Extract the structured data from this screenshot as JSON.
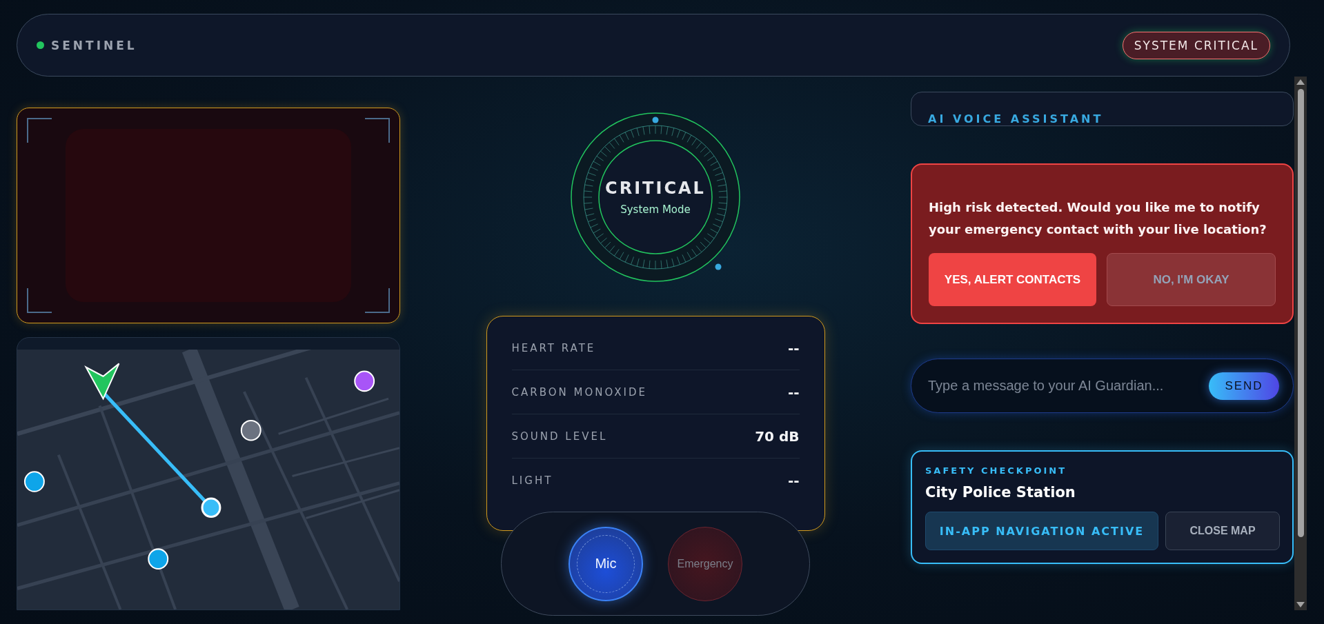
{
  "header": {
    "brand": "SENTINEL",
    "online": true,
    "badge": "SYSTEM CRITICAL"
  },
  "mode": {
    "title": "CRITICAL",
    "subtitle": "System Mode"
  },
  "sensors": [
    {
      "label": "HEART RATE",
      "value": "--"
    },
    {
      "label": "CARBON MONOXIDE",
      "value": "--"
    },
    {
      "label": "SOUND LEVEL",
      "value": "70 dB"
    },
    {
      "label": "LIGHT",
      "value": "--"
    }
  ],
  "controls": [
    {
      "label": "Mic",
      "kind": "mic",
      "active": true
    },
    {
      "label": "Emergency",
      "kind": "emergency",
      "active": false
    }
  ],
  "assistant": {
    "title": "AI VOICE ASSISTANT"
  },
  "alert": {
    "message": "High risk detected. Would you like me to notify your emergency contact with your live location?",
    "buttons": [
      {
        "label": "YES, ALERT CONTACTS",
        "kind": "primary"
      },
      {
        "label": "NO, I'M OKAY",
        "kind": "secondary"
      }
    ]
  },
  "chat": {
    "placeholder": "Type a message to your AI Guardian...",
    "send": "SEND"
  },
  "checkpoint": {
    "eyebrow": "SAFETY CHECKPOINT",
    "name": "City Police Station",
    "buttons": [
      {
        "label": "IN-APP NAVIGATION ACTIVE",
        "kind": "status"
      },
      {
        "label": "CLOSE MAP",
        "kind": "secondary"
      }
    ]
  }
}
